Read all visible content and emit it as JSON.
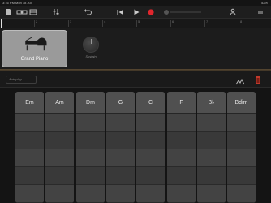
{
  "status": {
    "time": "3:16 PM",
    "date": "Mon 18 Jul",
    "battery": "52%"
  },
  "toolbar": {
    "icons": [
      "my-songs",
      "browser",
      "tracks-view",
      "mixer",
      "undo",
      "go-to-beginning",
      "play",
      "record",
      "master-volume",
      "settings"
    ],
    "record_color": "#e0262d"
  },
  "ruler": {
    "markers": [
      "1",
      "2",
      "3",
      "4",
      "5",
      "6",
      "7",
      "8"
    ]
  },
  "instrument": {
    "name": "Grand Piano",
    "knob_label": "Sustain"
  },
  "controls": {
    "autoplay_label": "Autoplay"
  },
  "chords": [
    "Em",
    "Am",
    "Dm",
    "G",
    "C",
    "F",
    "B♭",
    "Bdim"
  ]
}
